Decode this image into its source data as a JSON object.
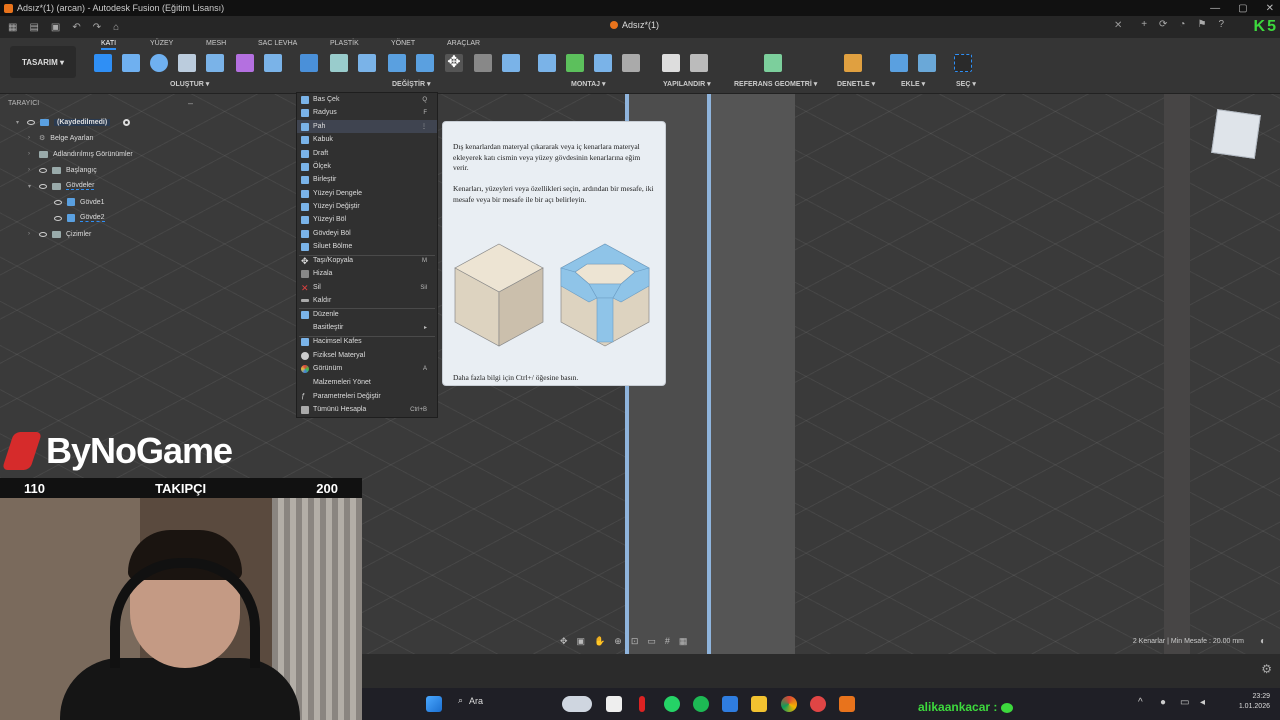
{
  "window": {
    "title": "Adsız*(1) (arcan) - Autodesk Fusion (Eğitim Lisansı)",
    "doc_tab": "Adsız*(1)",
    "controls": [
      "minimize",
      "maximize",
      "close"
    ]
  },
  "top_badge": "K5",
  "workspace": "TASARIM",
  "ribbon_tabs": [
    "KATI",
    "YÜZEY",
    "MESH",
    "SAC LEVHA",
    "PLASTİK",
    "YÖNET",
    "ARAÇLAR"
  ],
  "active_tab": "KATI",
  "groups": [
    "OLUŞTUR",
    "DEĞİŞTİR",
    "MONTAJ",
    "YAPILANDIR",
    "REFERANS GEOMETRİ",
    "DENETLE",
    "EKLE",
    "SEÇ"
  ],
  "browser": {
    "title": "TARAYICI",
    "items": [
      {
        "label": "(Kaydedilmedi)",
        "level": 0
      },
      {
        "label": "Belge Ayarları",
        "level": 1
      },
      {
        "label": "Adlandırılmış Görünümler",
        "level": 1
      },
      {
        "label": "Başlangıç",
        "level": 1
      },
      {
        "label": "Gövdeler",
        "level": 1
      },
      {
        "label": "Gövde1",
        "level": 2
      },
      {
        "label": "Gövde2",
        "level": 2
      },
      {
        "label": "Çizimler",
        "level": 1
      }
    ]
  },
  "menu": {
    "items": [
      {
        "label": "Bas Çek",
        "shortcut": "Q"
      },
      {
        "label": "Radyus",
        "shortcut": "F"
      },
      {
        "label": "Pah",
        "shortcut": "⋮"
      },
      {
        "label": "Kabuk",
        "shortcut": ""
      },
      {
        "label": "Draft",
        "shortcut": ""
      },
      {
        "label": "Ölçek",
        "shortcut": ""
      },
      {
        "label": "Birleştir",
        "shortcut": ""
      },
      {
        "label": "Yüzeyi Dengele",
        "shortcut": ""
      },
      {
        "label": "Yüzeyi Değiştir",
        "shortcut": ""
      },
      {
        "label": "Yüzeyi Böl",
        "shortcut": ""
      },
      {
        "label": "Gövdeyi Böl",
        "shortcut": ""
      },
      {
        "label": "Siluet Bölme",
        "shortcut": ""
      },
      {
        "label": "Taşı/Kopyala",
        "shortcut": "M"
      },
      {
        "label": "Hizala",
        "shortcut": ""
      },
      {
        "label": "Sil",
        "shortcut": "Sil"
      },
      {
        "label": "Kaldır",
        "shortcut": ""
      },
      {
        "label": "Düzenle",
        "shortcut": ""
      },
      {
        "label": "Basitleştir",
        "shortcut": "▸"
      },
      {
        "label": "Hacimsel Kafes",
        "shortcut": ""
      },
      {
        "label": "Fiziksel Materyal",
        "shortcut": ""
      },
      {
        "label": "Görünüm",
        "shortcut": "A"
      },
      {
        "label": "Malzemeleri Yönet",
        "shortcut": ""
      },
      {
        "label": "Parametreleri Değiştir",
        "shortcut": ""
      },
      {
        "label": "Tümünü Hesapla",
        "shortcut": "Ctrl+B"
      }
    ]
  },
  "tooltip": {
    "p1": "Dış kenarlardan materyal çıkararak veya iç kenarlara materyal ekleyerek katı cismin veya yüzey gövdesinin kenarlarına eğim verir.",
    "p2": "Kenarları, yüzeyleri veya özellikleri seçin, ardından bir mesafe, iki mesafe veya bir mesafe ile bir açı belirleyin.",
    "footer": "Daha fazla bilgi için Ctrl+/ öğesine basın."
  },
  "status": "2 Kenarlar | Min Mesafe : 20.00 mm",
  "stream": {
    "brand": "ByNoGame",
    "followers_current": "110",
    "followers_label": "TAKIPÇI",
    "followers_goal": "200",
    "chat_user": "alikaankacar :"
  },
  "taskbar": {
    "search": "Ara",
    "time": "23:29",
    "date": "1.01.2026"
  }
}
